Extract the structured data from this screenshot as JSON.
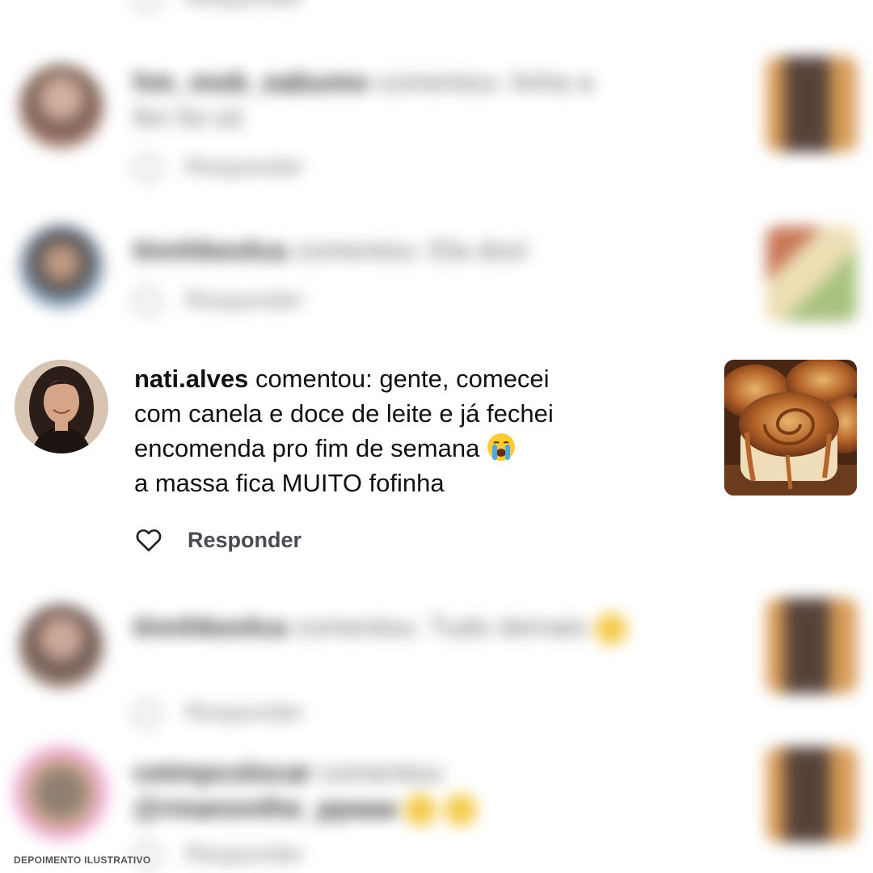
{
  "focused_comment": {
    "username": "nati.alves",
    "action": "comentou:",
    "lines": [
      "gente, comecei",
      "com canela e doce de leite e já fechei",
      "encomenda pro fim de semana",
      "a massa fica MUITO fofinha"
    ],
    "emoji": "loudly-crying-face",
    "reply_label": "Responder",
    "like_icon": "heart-outline-icon",
    "thumbnail": "cinnamon-roll-photo"
  },
  "blurred_comments": [
    {
      "username": "hm_mob_eabumo",
      "text": "comentou: linha a",
      "text2": "fim foi só",
      "reply_label": "Responder"
    },
    {
      "username": "tinnhkeolca",
      "text": "comentou: Ela dos!",
      "reply_label": "Responder"
    },
    {
      "username": "tinnhkeolca",
      "text": "comentou: Tudo demais",
      "reply_label": "Responder"
    },
    {
      "username": "cetmpcolocar",
      "text": "comentou:",
      "text2": "@rmanonthe_ppaaa",
      "reply_label": "Responder"
    }
  ],
  "disclaimer": "DEPOIMENTO ILUSTRATIVO",
  "colors": {
    "text": "#111111",
    "reply": "#4a4a52",
    "background": "#ffffff"
  }
}
